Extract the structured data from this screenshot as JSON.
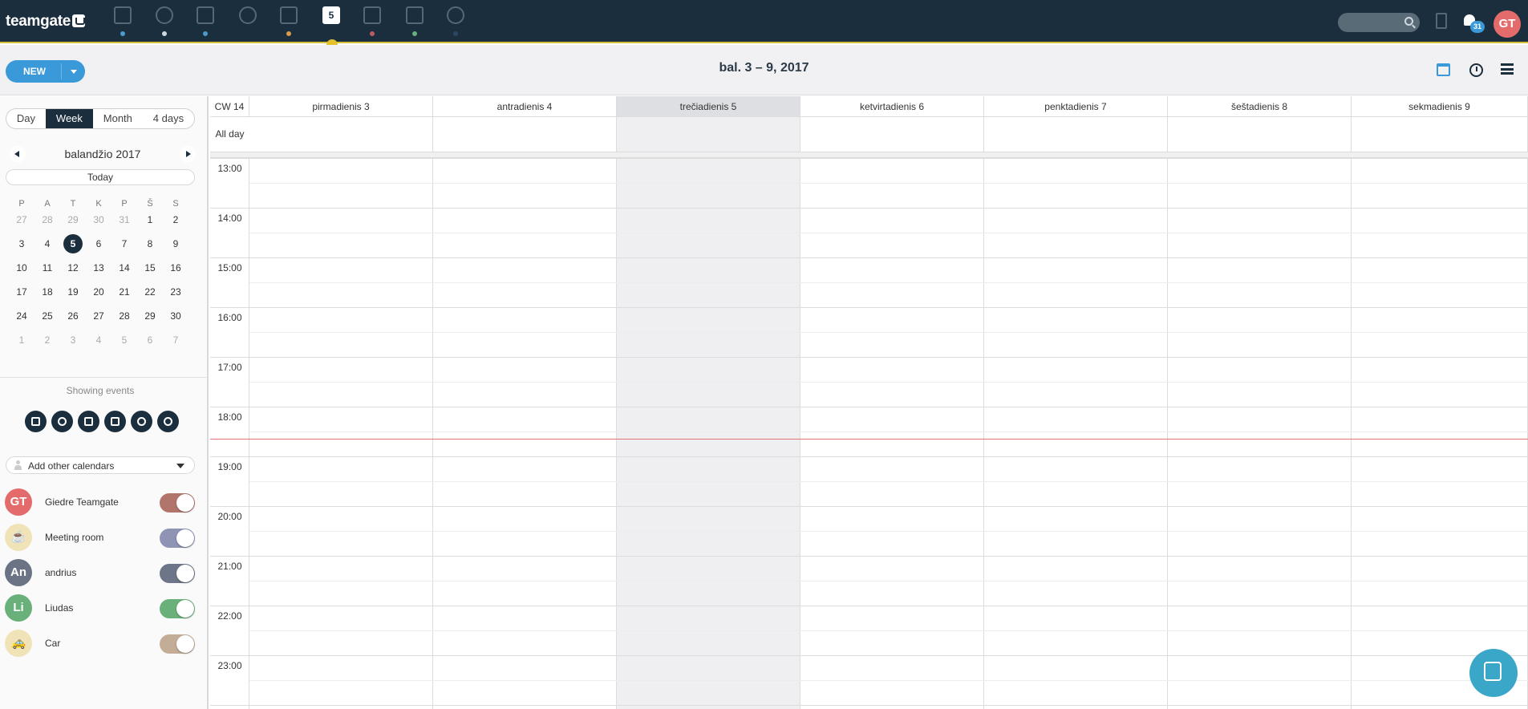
{
  "topbar": {
    "logo_text": "teamgate",
    "nav": [
      {
        "name": "dashboard",
        "dot": "#4b9ccc"
      },
      {
        "name": "leads",
        "dot": "#cfd8df"
      },
      {
        "name": "companies",
        "dot": "#4b9ccc"
      },
      {
        "name": "people",
        "dot": ""
      },
      {
        "name": "deals",
        "dot": "#d99a4a"
      },
      {
        "name": "calendar",
        "dot": "",
        "label": "5"
      },
      {
        "name": "inbox",
        "dot": "#c05a62"
      },
      {
        "name": "tasks",
        "dot": "#6ab07a"
      },
      {
        "name": "reports",
        "dot": "#2d4760"
      }
    ],
    "notifications_count": "31",
    "avatar_initials": "GT",
    "avatar_color": "#e36b6b"
  },
  "subbar": {
    "new_label": "NEW",
    "range_title": "bal. 3 – 9, 2017"
  },
  "view_tabs": [
    "Day",
    "Week",
    "Month",
    "4 days"
  ],
  "active_view": "Week",
  "mini_calendar": {
    "title": "balandžio 2017",
    "today_label": "Today",
    "weekdays": [
      "P",
      "A",
      "T",
      "K",
      "P",
      "Š",
      "S"
    ],
    "weeks": [
      [
        "27",
        "28",
        "29",
        "30",
        "31",
        "1",
        "2"
      ],
      [
        "3",
        "4",
        "5",
        "6",
        "7",
        "8",
        "9"
      ],
      [
        "10",
        "11",
        "12",
        "13",
        "14",
        "15",
        "16"
      ],
      [
        "17",
        "18",
        "19",
        "20",
        "21",
        "22",
        "23"
      ],
      [
        "24",
        "25",
        "26",
        "27",
        "28",
        "29",
        "30"
      ],
      [
        "1",
        "2",
        "3",
        "4",
        "5",
        "6",
        "7"
      ]
    ],
    "selected": "5"
  },
  "showing_events_label": "Showing events",
  "filters": [
    "calendar-filter-icon",
    "phone-filter-icon",
    "task-filter-icon",
    "gift-filter-icon",
    "flight-filter-icon",
    "bell-filter-icon"
  ],
  "add_calendars_label": "Add other calendars",
  "calendars": [
    {
      "name": "Giedre Teamgate",
      "initials": "GT",
      "avatar_color": "#e36b6b",
      "toggle_color": "#b2756c"
    },
    {
      "name": "Meeting room",
      "initials": "☕",
      "avatar_color": "#f0e3b8",
      "toggle_color": "#8f93b4"
    },
    {
      "name": "andrius",
      "initials": "An",
      "avatar_color": "#6a7484",
      "toggle_color": "#6d7588"
    },
    {
      "name": "Liudas",
      "initials": "Li",
      "avatar_color": "#6ab07a",
      "toggle_color": "#6ab07a"
    },
    {
      "name": "Car",
      "initials": "🚕",
      "avatar_color": "#f0e3b8",
      "toggle_color": "#c4ad96"
    }
  ],
  "week": {
    "cw_label": "CW 14",
    "allday_label": "All day",
    "days": [
      "pirmadienis 3",
      "antradienis 4",
      "trečiadienis 5",
      "ketvirtadienis 6",
      "penktadienis 7",
      "šeštadienis 8",
      "sekmadienis 9"
    ],
    "today_index": 2,
    "hours": [
      "13:00",
      "14:00",
      "15:00",
      "16:00",
      "17:00",
      "18:00",
      "19:00",
      "20:00",
      "21:00",
      "22:00",
      "23:00"
    ]
  }
}
